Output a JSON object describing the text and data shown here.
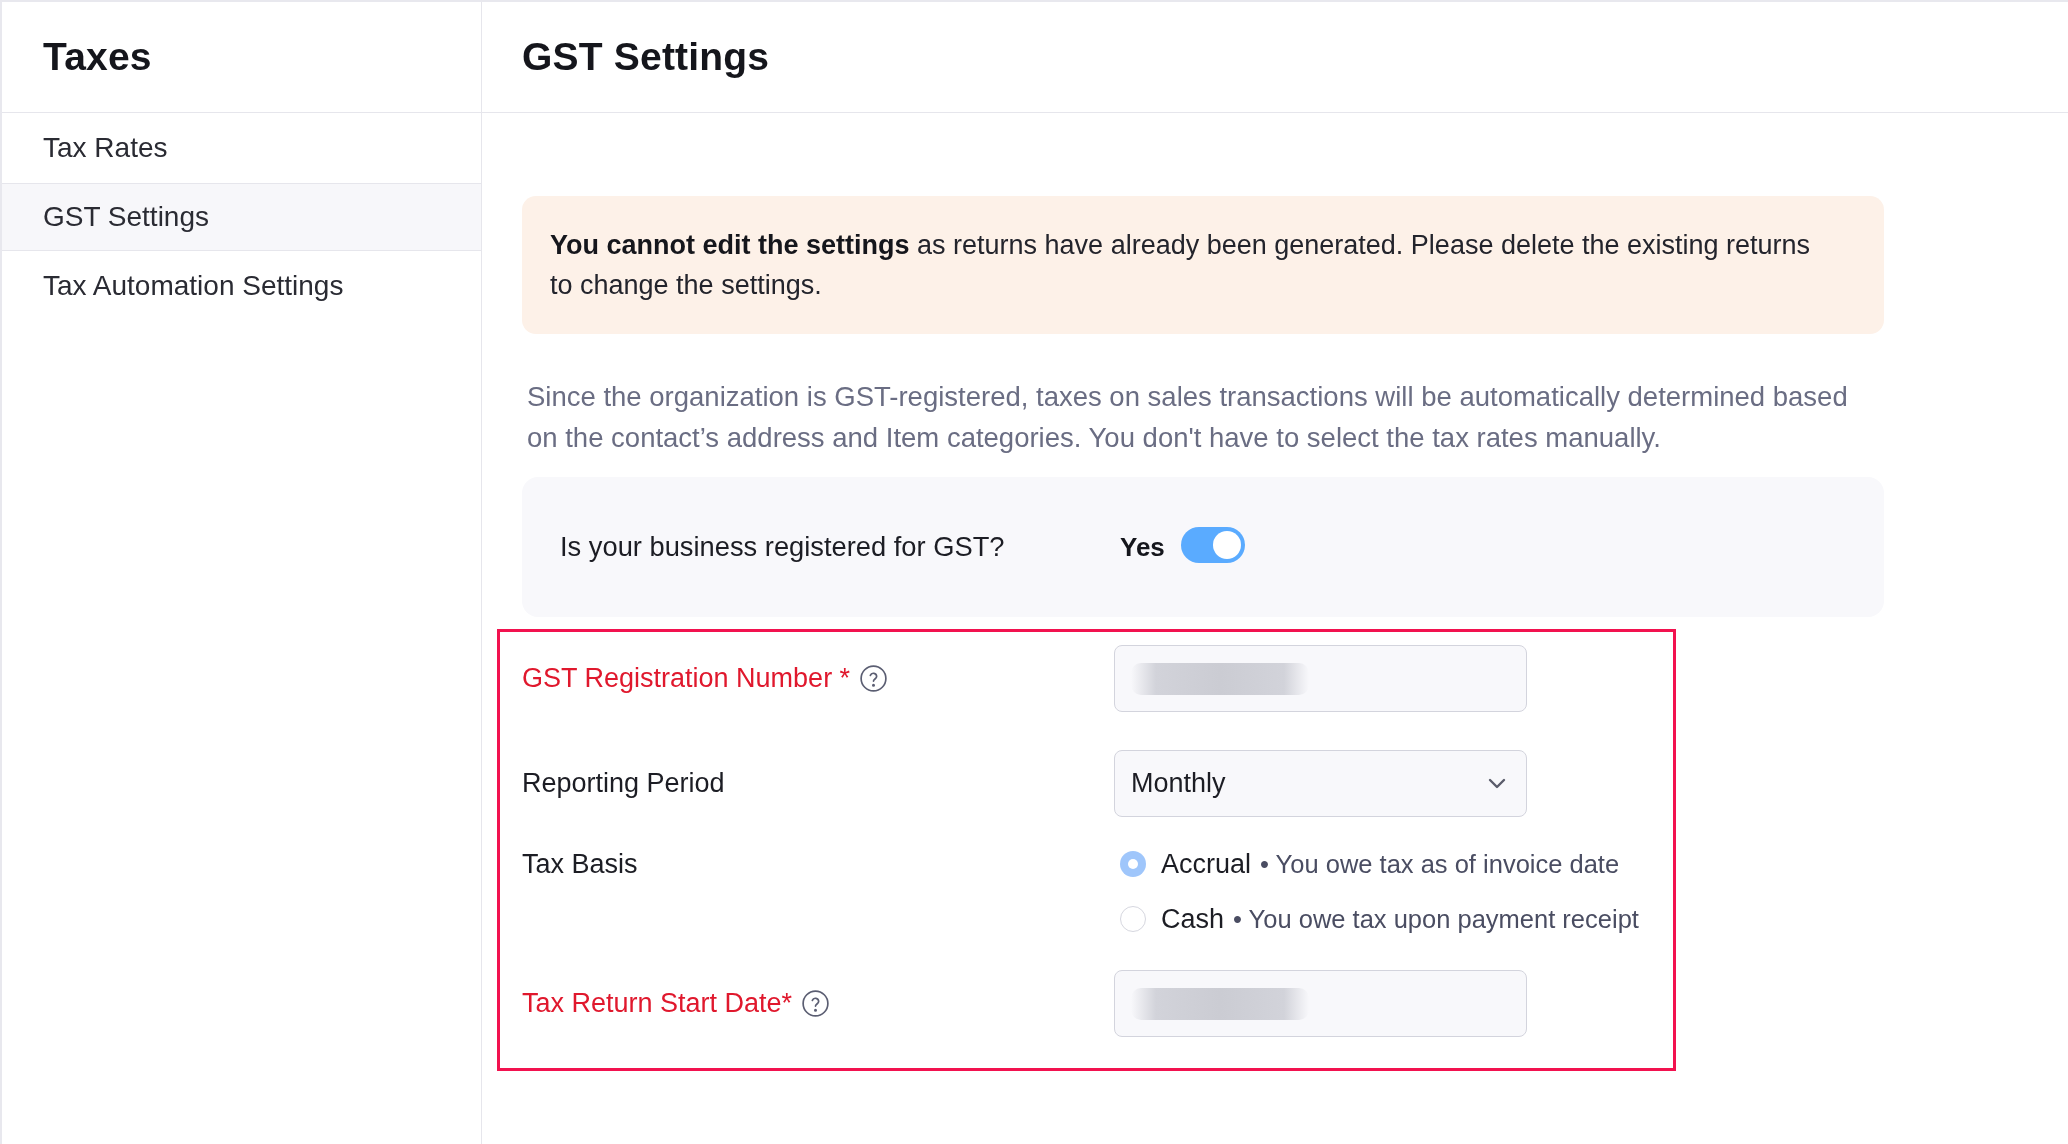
{
  "sidebar": {
    "title": "Taxes",
    "items": [
      {
        "label": "Tax Rates",
        "selected": false
      },
      {
        "label": "GST Settings",
        "selected": true
      },
      {
        "label": "Tax Automation Settings",
        "selected": false
      }
    ]
  },
  "page": {
    "title": "GST Settings"
  },
  "notice": {
    "text": "**You cannot edit the settings** as returns have already been generated. Please delete the existing returns to change the settings."
  },
  "description": "Since the organization is GST-registered, taxes on sales transactions will be automatically determined based on the contact’s address and Item categories. You don't have to select the tax rates manually.",
  "gst_registration": {
    "question": "Is your business registered for GST?",
    "answer": "Yes",
    "on": true
  },
  "form": {
    "highlighted": true,
    "fields": [
      {
        "kind": "text",
        "label": "GST Registration Number *",
        "required": true,
        "help": true,
        "blurred": true
      },
      {
        "kind": "select",
        "label": "Reporting Period",
        "required": false,
        "value": "Monthly"
      },
      {
        "kind": "radio",
        "label": "Tax Basis",
        "required": false,
        "options": [
          {
            "label": "Accrual",
            "note": "• You owe tax as of invoice date",
            "selected": true
          },
          {
            "label": "Cash",
            "note": "• You owe tax upon payment receipt",
            "selected": false
          }
        ]
      },
      {
        "kind": "text",
        "label": "Tax Return Start Date*",
        "required": true,
        "help": true,
        "blurred": true
      }
    ]
  }
}
